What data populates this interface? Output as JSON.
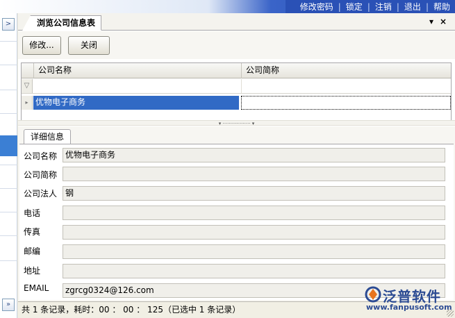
{
  "topmenu": {
    "items": [
      "修改密码",
      "锁定",
      "注销",
      "退出",
      "帮助"
    ]
  },
  "leftrail": {
    "expand_glyph": ">",
    "bottom_glyph": "»"
  },
  "tabstrip": {
    "tab_label": "浏览公司信息表",
    "dropdown_glyph": "▾",
    "close_glyph": "×"
  },
  "toolbar": {
    "edit_label": "修改...",
    "close_label": "关闭"
  },
  "grid": {
    "columns": [
      "公司名称",
      "公司简称"
    ],
    "filter_glyph": "▽",
    "rows": [
      {
        "indicator": "▸",
        "company_name": "优物电子商务",
        "short_name": ""
      }
    ]
  },
  "splitter": {
    "glyph": "▾ ·················· ▾"
  },
  "detail": {
    "tab_label": "详细信息",
    "fields": [
      {
        "label": "公司名称",
        "value": "优物电子商务"
      },
      {
        "label": "公司简称",
        "value": ""
      },
      {
        "label": "公司法人",
        "value": "钢"
      },
      {
        "label": "电话",
        "value": ""
      },
      {
        "label": "传真",
        "value": ""
      },
      {
        "label": "邮编",
        "value": ""
      },
      {
        "label": "地址",
        "value": ""
      },
      {
        "label": "EMAIL",
        "value": "zgrcg0324@126.com"
      }
    ]
  },
  "status": {
    "text": "共 1 条记录，耗时：00 ： 00 ： 125（已选中 1 条记录）"
  },
  "logo": {
    "name": "泛普软件",
    "url": "www.fanpusoft.com"
  },
  "colors": {
    "topbar_blue": "#2a51b6",
    "selection_blue": "#316ac5",
    "logo_blue": "#2c4b93"
  }
}
